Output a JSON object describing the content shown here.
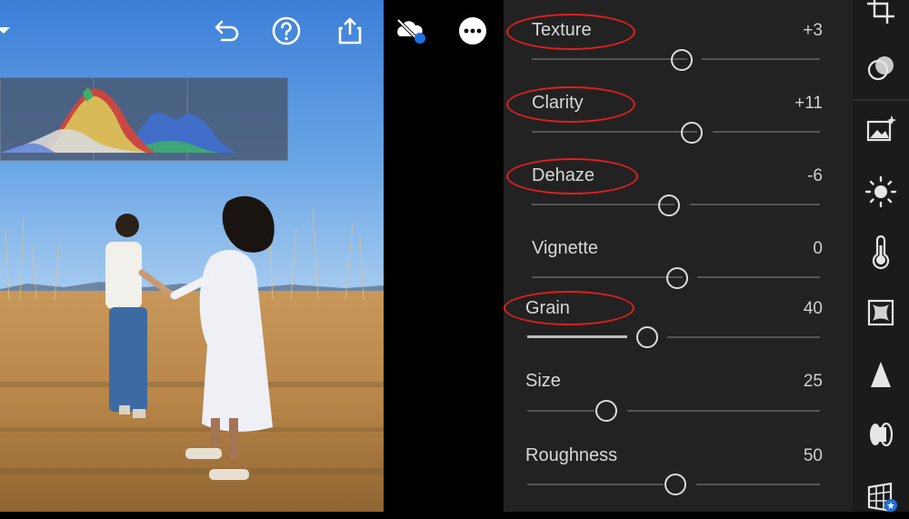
{
  "top_bar": {
    "icons": [
      "chevron-down-icon",
      "undo-icon",
      "help-icon",
      "share-icon",
      "cloud-off-icon",
      "more-icon"
    ]
  },
  "histogram": {
    "colors": {
      "red": "#d8453a",
      "yellow": "#d8c25a",
      "green": "#3fb06a",
      "blue": "#3f6fd0",
      "gray": "#c9c9c9"
    }
  },
  "panel": {
    "sliders": [
      {
        "label": "Texture",
        "value": "+3",
        "level": 0.515,
        "highlighted": true
      },
      {
        "label": "Clarity",
        "value": "+11",
        "level": 0.555,
        "highlighted": true
      },
      {
        "label": "Dehaze",
        "value": "-6",
        "level": 0.47,
        "highlighted": true
      },
      {
        "label": "Vignette",
        "value": "0",
        "level": 0.5,
        "highlighted": false
      },
      {
        "label": "Grain",
        "value": "40",
        "level": 0.4,
        "highlighted": true
      },
      {
        "label": "Size",
        "value": "25",
        "level": 0.27,
        "highlighted": false
      },
      {
        "label": "Roughness",
        "value": "50",
        "level": 0.5,
        "highlighted": false
      }
    ],
    "highlight_color": "#e0201c"
  },
  "toolbar": {
    "tools": [
      "crop-icon",
      "selective-mask-icon",
      "presets-icon",
      "light-icon",
      "color-icon",
      "effects-icon",
      "detail-icon",
      "optics-icon",
      "geometry-icon"
    ]
  }
}
